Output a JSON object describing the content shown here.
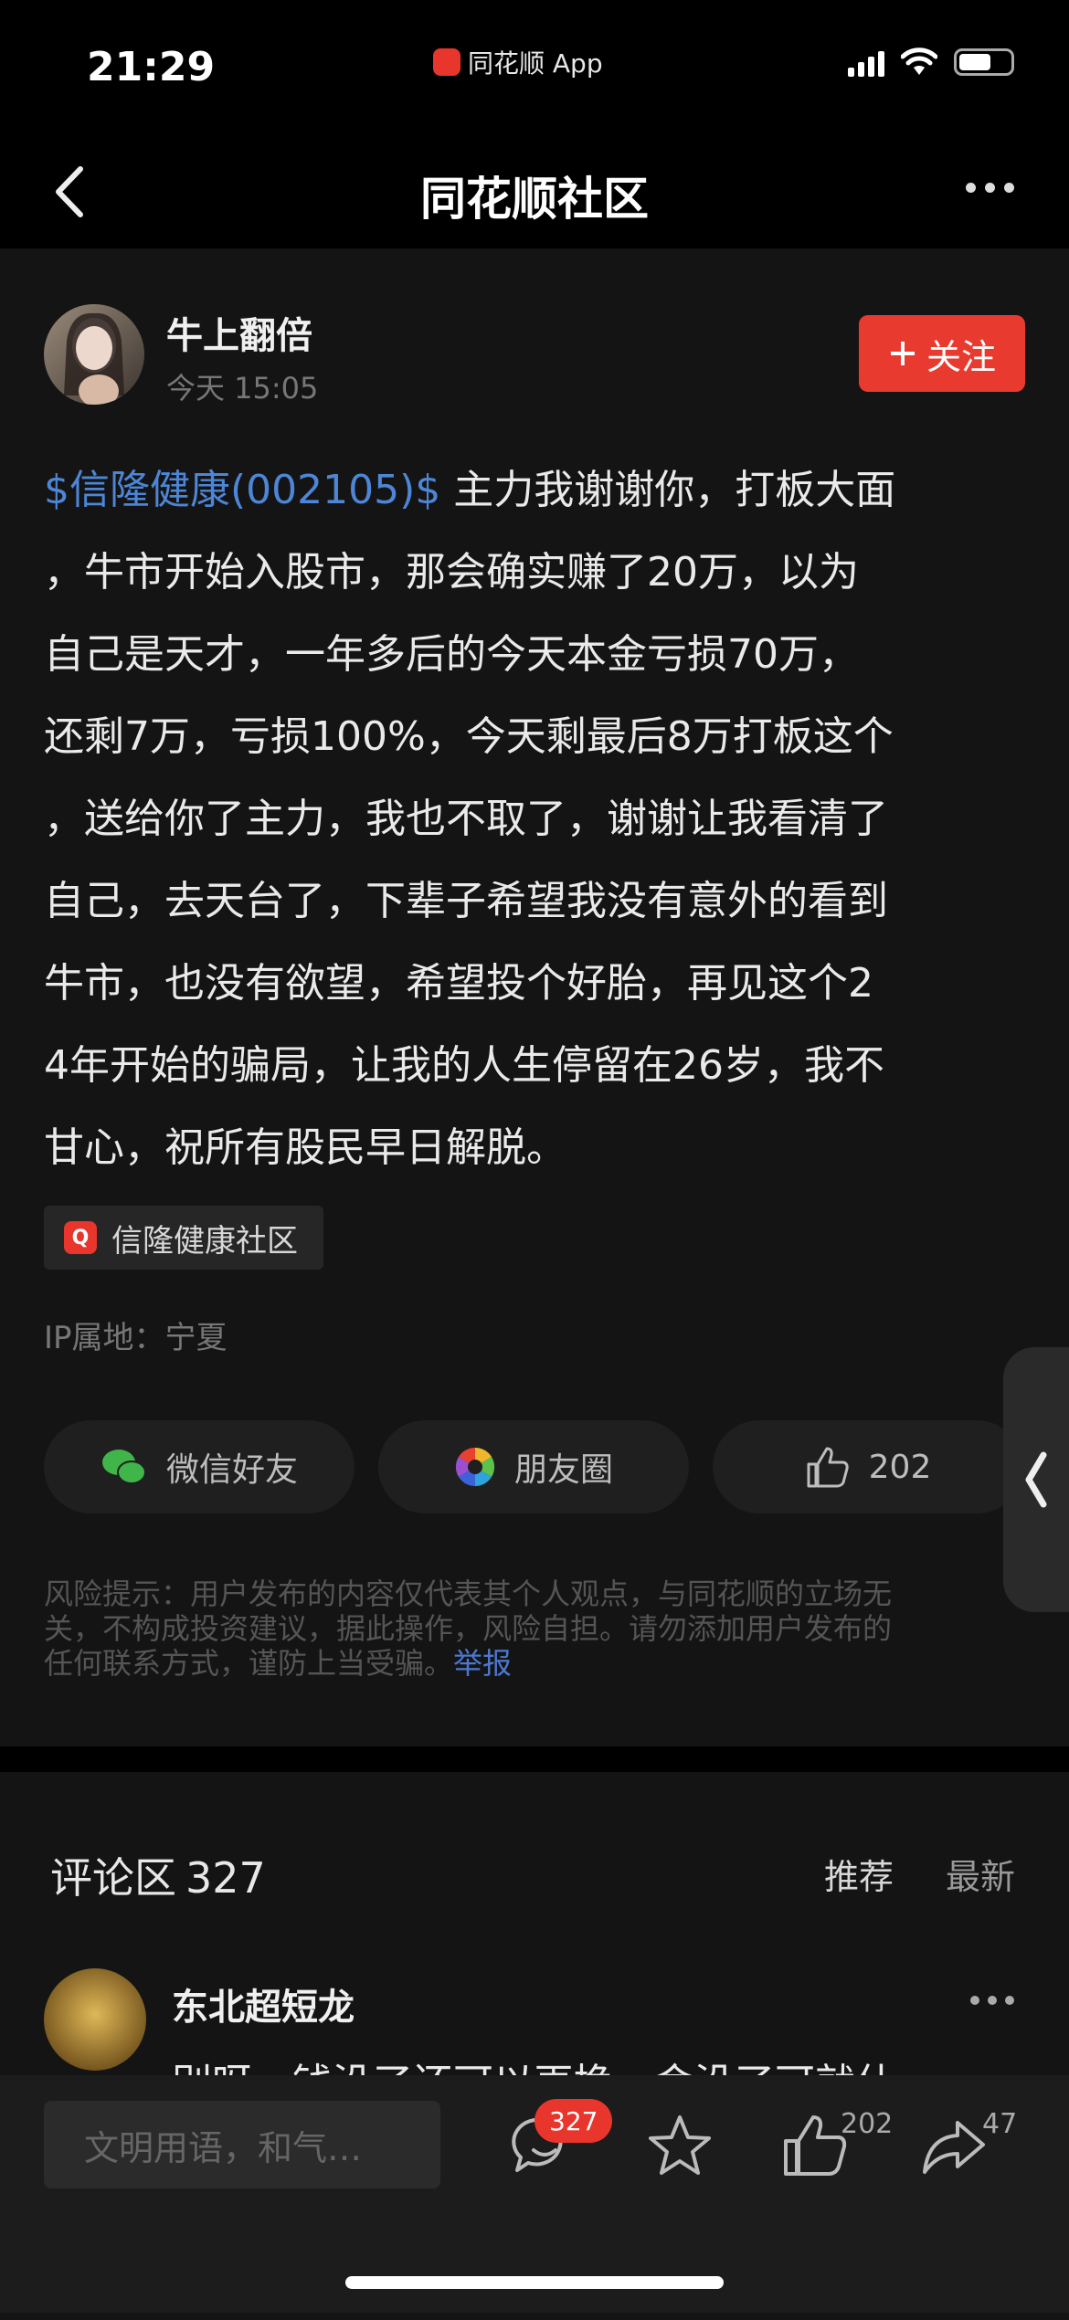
{
  "status_bar": {
    "time": "21:29",
    "app_name": "同花顺 App",
    "icons": [
      "signal-icon",
      "wifi-icon",
      "battery-icon"
    ]
  },
  "header": {
    "title": "同花顺社区",
    "icons": [
      "back-icon",
      "more-icon"
    ]
  },
  "post": {
    "author": "牛上翻倍",
    "time": "今天 15:05",
    "follow_label": "关注",
    "stock_link": "$信隆健康(002105)$",
    "lines": [
      " 主力我谢谢你，打板大面",
      "，牛市开始入股市，那会确实赚了20万，以为",
      "自己是天才，一年多后的今天本金亏损70万，",
      "还剩7万，亏损100%，今天剩最后8万打板这个",
      "，送给你了主力，我也不取了，谢谢让我看清了",
      "自己，去天台了，下辈子希望我没有意外的看到",
      "牛市，也没有欲望，希望投个好胎，再见这个2",
      "4年开始的骗局，让我的人生停留在26岁，我不",
      "甘心，祝所有股民早日解脱。"
    ],
    "topic": "信隆健康社区",
    "ip_location": "IP属地：宁夏",
    "share": {
      "wechat": "微信好友",
      "moments": "朋友圈",
      "likes": "202"
    },
    "disclaimer_lines": [
      "风险提示：用户发布的内容仅代表其个人观点，与同花顺的立场无",
      "关，不构成投资建议，据此操作，风险自担。请勿添加用户发布的",
      "任何联系方式，谨防上当受骗。"
    ],
    "report_link": "举报"
  },
  "comments": {
    "title": "评论区",
    "count": "327",
    "sort_recommend": "推荐",
    "sort_latest": "最新",
    "first": {
      "author": "东北超短龙",
      "text_partial": "别呀，钱没了还可以再挣，命没了可就什"
    }
  },
  "bottom_bar": {
    "input_placeholder": "文明用语，和气…",
    "comment_badge": "327",
    "like_count": "202",
    "share_count": "47",
    "icons": [
      "comment-icon",
      "star-icon",
      "thumb-up-icon",
      "share-icon"
    ]
  },
  "colors": {
    "accent_red": "#e8362c",
    "link_blue": "#4d86d6",
    "background": "#000000",
    "card": "#141414"
  }
}
